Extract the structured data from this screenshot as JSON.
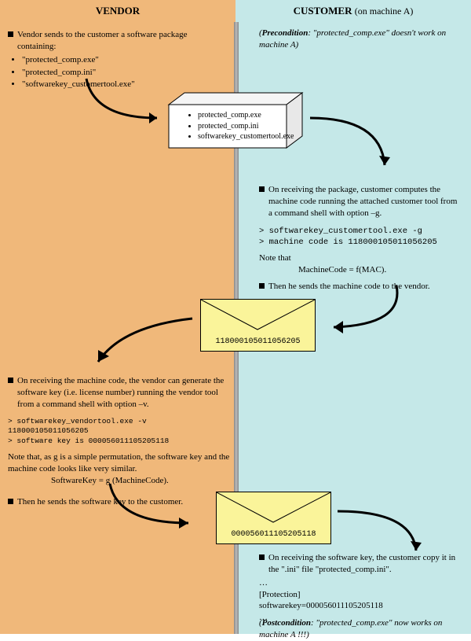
{
  "headers": {
    "vendor": "VENDOR",
    "customer": "CUSTOMER",
    "customer_note": "(on machine A)"
  },
  "vendor_step1": {
    "text": "Vendor sends to the customer a software package containing:",
    "items": [
      "\"protected_comp.exe\"",
      "\"protected_comp.ini\"",
      "\"softwarekey_customertool.exe\""
    ]
  },
  "precondition": {
    "label": "Precondition",
    "text": ": \"protected_comp.exe\" doesn't work on machine A"
  },
  "package_box": {
    "items": [
      "protected_comp.exe",
      "protected_comp.ini",
      "softwarekey_customertool.exe"
    ]
  },
  "customer_step1": {
    "text": "On receiving the package, customer computes the machine code running the attached customer tool from a command shell with option –g.",
    "cmd1": "> softwarekey_customertool.exe -g",
    "cmd2": "> machine code is 118000105011056205",
    "note_prefix": "Note that",
    "note_formula": "MachineCode = f(MAC).",
    "text2": "Then he sends the machine code to the vendor."
  },
  "envelope1": {
    "code": "118000105011056205"
  },
  "vendor_step2": {
    "text": "On receiving the machine code, the vendor can generate the software key (i.e. license number) running the vendor tool from a command shell with option –v.",
    "cmd1": "> softwarekey_vendortool.exe -v  118000105011056205",
    "cmd2": "> software key is 000056011105205118",
    "note": "Note that, as g is a simple permutation, the software key and the machine code looks like very similar.",
    "formula": "SoftwareKey = g (MachineCode).",
    "text2": "Then he sends the software key to the customer."
  },
  "envelope2": {
    "code": "000056011105205118"
  },
  "customer_step2": {
    "text": "On receiving the software key, the customer copy it in the \".ini\" file \"protected_comp.ini\".",
    "ini1": "…",
    "ini2": "[Protection]",
    "ini3": "softwarekey=000056011105205118",
    "ini4": "…"
  },
  "postcondition": {
    "label": "Postcondition",
    "text": ": \"protected_comp.exe\" now works on machine A !!!"
  }
}
